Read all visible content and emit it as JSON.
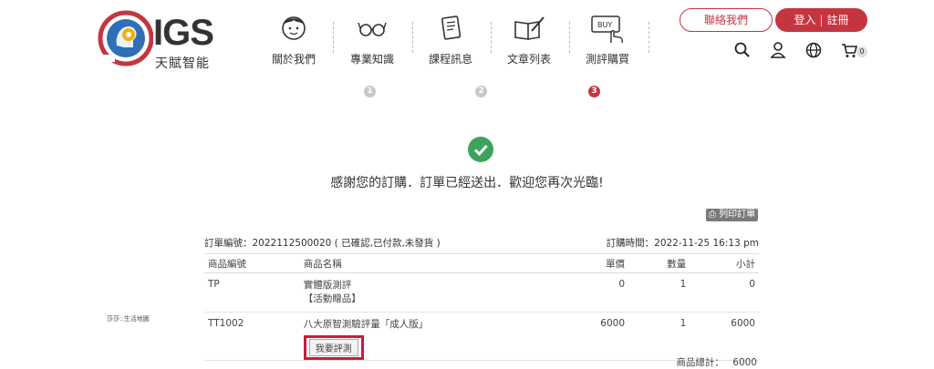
{
  "brand": {
    "logo_text": "IGS",
    "logo_sub": "天賦智能"
  },
  "nav": {
    "items": [
      {
        "label": "關於我們",
        "icon": "person-face-icon"
      },
      {
        "label": "專業知識",
        "icon": "glasses-icon"
      },
      {
        "label": "課程訊息",
        "icon": "book-icon"
      },
      {
        "label": "文章列表",
        "icon": "open-book-pen-icon"
      },
      {
        "label": "測評購買",
        "icon": "buy-hand-icon"
      }
    ]
  },
  "header_buttons": {
    "contact": "聯絡我們",
    "login": "登入",
    "register": "註冊",
    "cart_count": "0"
  },
  "steps": {
    "labels": [
      "1",
      "2",
      "3"
    ],
    "active_index": 3,
    "active_color": "#c53540"
  },
  "confirmation": {
    "message": "感謝您的訂購．訂單已經送出．歡迎您再次光臨!",
    "check_color": "#3aa55a"
  },
  "order": {
    "print_label": "列印訂單",
    "number_text": "訂單編號：2022112500020 ( 已確認,已付款,未發貨 )",
    "time_text": "訂購時間：2022-11-25 16:13 pm",
    "columns": [
      "商品編號",
      "商品名稱",
      "單價",
      "數量",
      "小計"
    ],
    "rows": [
      {
        "code": "TP",
        "name": "實體版測評",
        "note": "【活動贈品】",
        "price": "0",
        "qty": "1",
        "subtotal": "0"
      },
      {
        "code": "TT1002",
        "name": "八大原智測驗評量「成人版」",
        "action": "我要評測",
        "price": "6000",
        "qty": "1",
        "subtotal": "6000"
      }
    ],
    "total_label": "商品總計：",
    "total_value": "6000"
  },
  "side_note": "莎莎::生活地圖",
  "colors": {
    "brand_red": "#c53540",
    "highlight_red": "#d0193a"
  }
}
